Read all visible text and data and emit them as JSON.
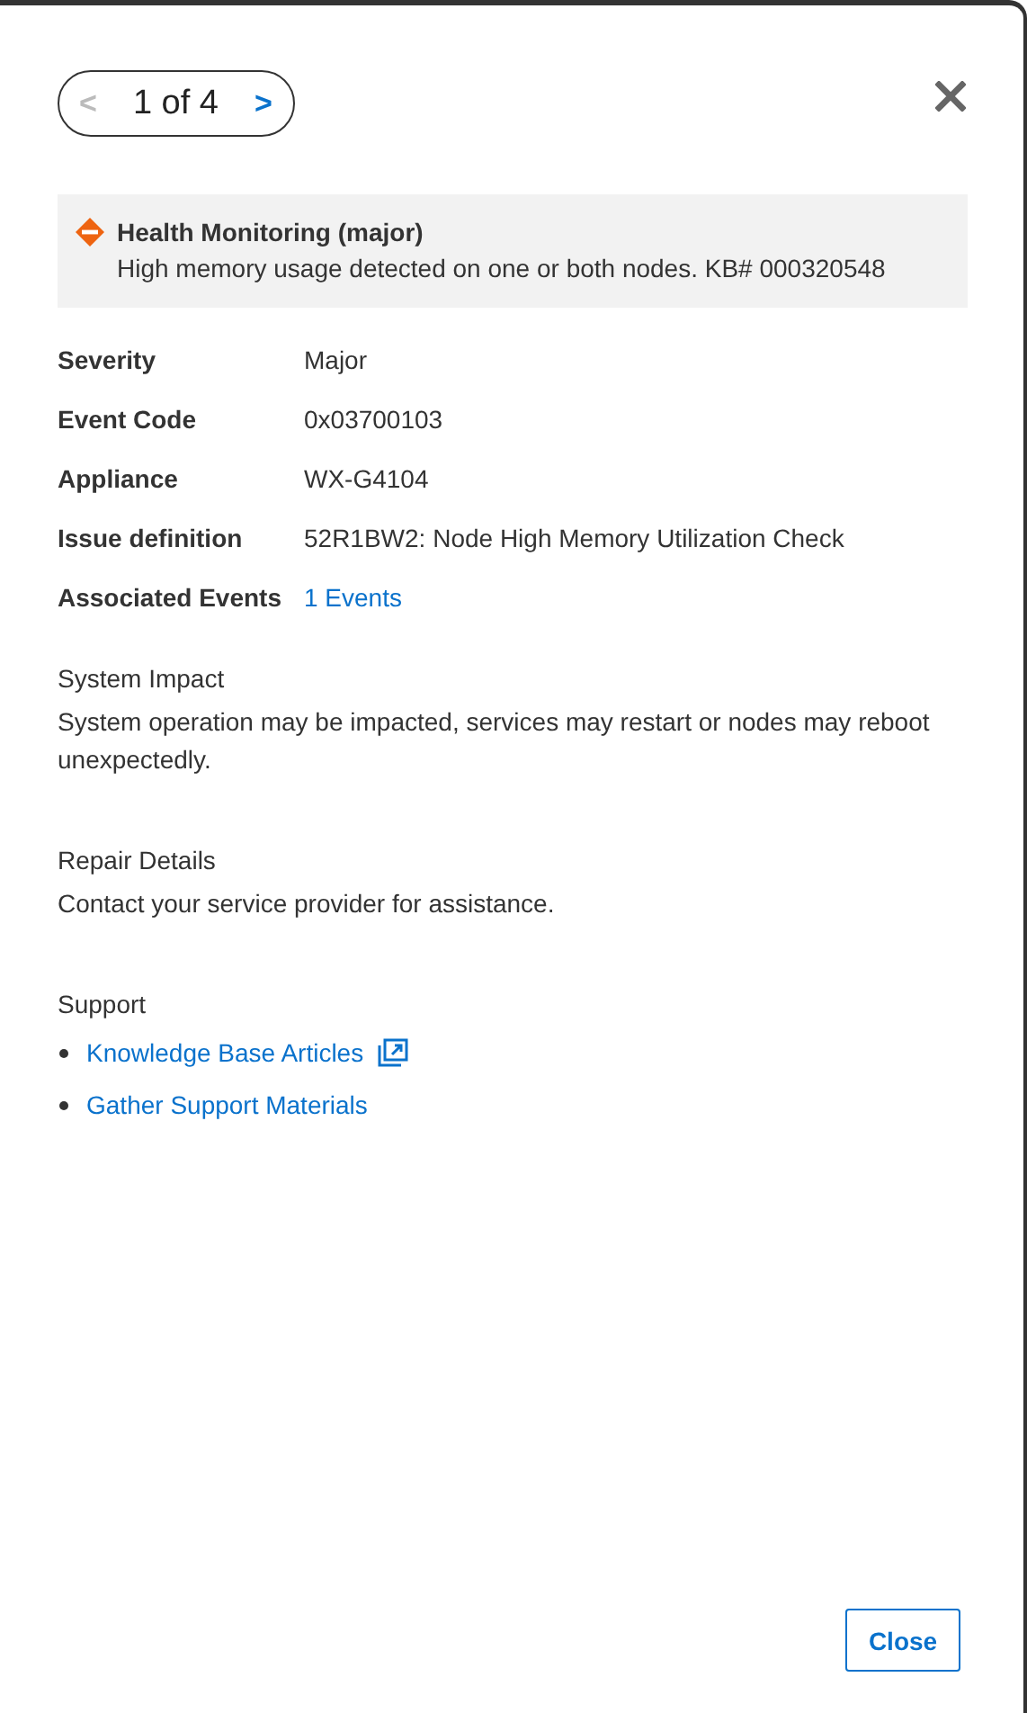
{
  "pager": {
    "prev": {
      "label": "<",
      "disabled": true
    },
    "position": "1 of 4",
    "next": {
      "label": ">",
      "disabled": false
    }
  },
  "alert": {
    "title": "Health Monitoring (major)",
    "message": "High memory usage detected on one or both nodes. KB# 000320548"
  },
  "details": [
    {
      "label": "Severity",
      "value": "Major",
      "kind": "text"
    },
    {
      "label": "Event Code",
      "value": "0x03700103",
      "kind": "text"
    },
    {
      "label": "Appliance",
      "value": "WX-G4104",
      "kind": "text"
    },
    {
      "label": "Issue definition",
      "value": "52R1BW2: Node High Memory Utilization Check",
      "kind": "text"
    },
    {
      "label": "Associated Events",
      "value": "1 Events",
      "kind": "link"
    }
  ],
  "sections": [
    {
      "heading": "System Impact",
      "body": "System operation may be impacted, services may restart or nodes may reboot unexpectedly."
    },
    {
      "heading": "Repair Details",
      "body": "Contact your service provider for assistance."
    }
  ],
  "support": {
    "heading": "Support",
    "links": [
      {
        "label": "Knowledge Base Articles",
        "external": true
      },
      {
        "label": "Gather Support Materials",
        "external": false
      }
    ]
  },
  "footer": {
    "close_button": "Close"
  }
}
